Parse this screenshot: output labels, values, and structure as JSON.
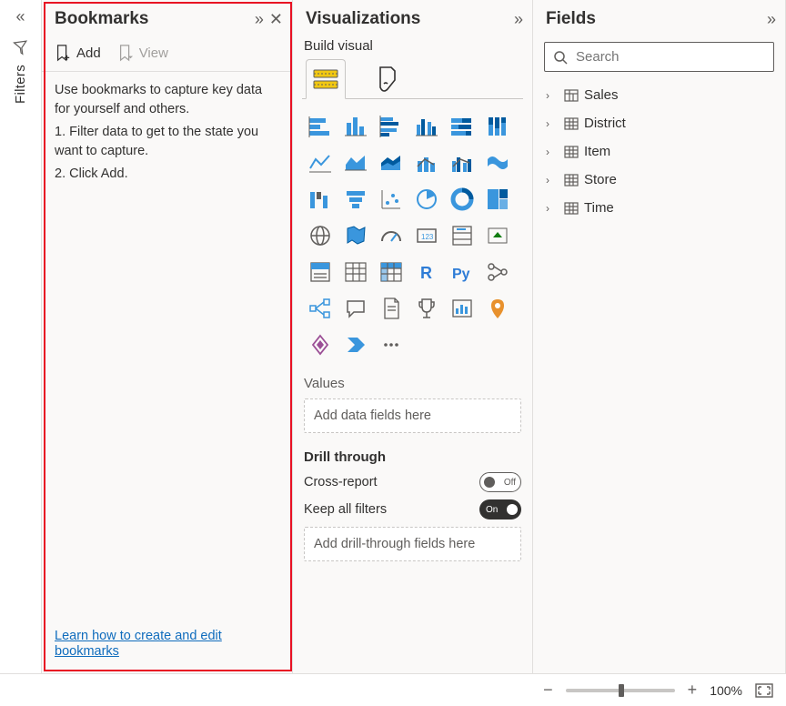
{
  "filters": {
    "label": "Filters"
  },
  "bookmarks": {
    "title": "Bookmarks",
    "add_label": "Add",
    "view_label": "View",
    "intro": "Use bookmarks to capture key data for yourself and others.",
    "step1": "1. Filter data to get to the state you want to capture.",
    "step2": "2. Click Add.",
    "learn_link": "Learn how to create and edit bookmarks"
  },
  "viz": {
    "title": "Visualizations",
    "subtitle": "Build visual",
    "values_label": "Values",
    "values_placeholder": "Add data fields here",
    "drill_label": "Drill through",
    "cross_report_label": "Cross-report",
    "cross_report_state": "Off",
    "keep_filters_label": "Keep all filters",
    "keep_filters_state": "On",
    "drill_placeholder": "Add drill-through fields here",
    "icons": [
      "stacked-bar",
      "stacked-column",
      "clustered-bar",
      "clustered-column",
      "100-stacked-bar",
      "100-stacked-column",
      "line",
      "area",
      "stacked-area",
      "line-stacked-column",
      "line-clustered-column",
      "ribbon",
      "waterfall",
      "funnel",
      "scatter",
      "pie",
      "donut",
      "treemap",
      "map",
      "filled-map",
      "gauge",
      "card",
      "multi-row-card",
      "kpi",
      "slicer",
      "table",
      "matrix",
      "r-visual",
      "py-visual",
      "key-influencers",
      "decomposition-tree",
      "qna",
      "paginated",
      "goals",
      "scorecard",
      "arcgis",
      "power-apps",
      "power-automate",
      "more"
    ]
  },
  "fields": {
    "title": "Fields",
    "search_placeholder": "Search",
    "tables": [
      {
        "name": "Sales",
        "icon": "sum"
      },
      {
        "name": "District",
        "icon": "table"
      },
      {
        "name": "Item",
        "icon": "table"
      },
      {
        "name": "Store",
        "icon": "table"
      },
      {
        "name": "Time",
        "icon": "table"
      }
    ]
  },
  "zoom": {
    "minus": "−",
    "plus": "+",
    "percent": "100%"
  }
}
